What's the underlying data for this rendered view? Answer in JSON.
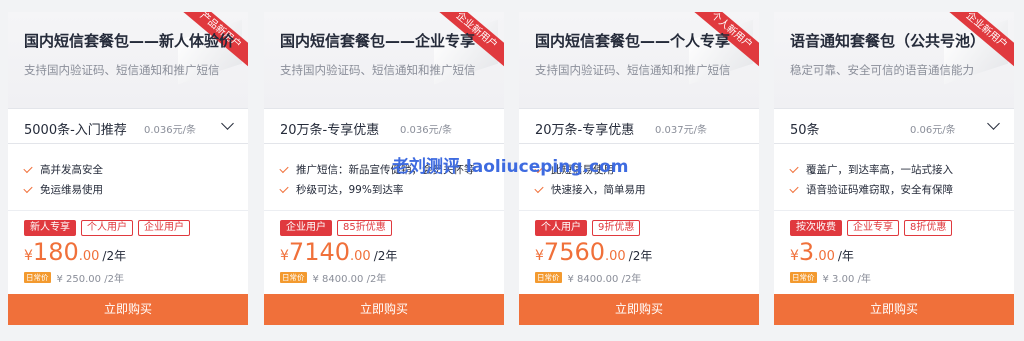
{
  "buy_label": "立即购买",
  "daily_badge_label": "日常价",
  "watermark": "老刘测评 laoliuceping.com",
  "cards": [
    {
      "ribbon": "产品新用户",
      "title": "国内短信套餐包——新人体验价",
      "subtitle": "支持国内验证码、短信通知和推广短信",
      "spec": "5000条-入门推荐",
      "unit_price": "0.036元/条",
      "features": [
        "高并发高安全",
        "免运维易使用"
      ],
      "tags": [
        {
          "label": "新人专享",
          "filled": true
        },
        {
          "label": "个人用户",
          "filled": false
        },
        {
          "label": "企业用户",
          "filled": false
        }
      ],
      "price_currency": "¥",
      "price_int": "180",
      "price_dec": ".00",
      "price_period": "/2年",
      "daily_price": "¥ 250.00 /2年"
    },
    {
      "ribbon": "企业新用户",
      "title": "国内短信套餐包——企业专享",
      "subtitle": "支持国内验证码、短信通知和推广短信",
      "spec": "20万条-专享优惠",
      "unit_price": "0.036元/条",
      "features": [
        "推广短信：新品宣传促销，会员关怀等",
        "秒级可达，99%到达率"
      ],
      "tags": [
        {
          "label": "企业用户",
          "filled": true
        },
        {
          "label": "85折优惠",
          "filled": false
        }
      ],
      "price_currency": "¥",
      "price_int": "7140",
      "price_dec": ".00",
      "price_period": "/2年",
      "daily_price": "¥ 8400.00 /2年"
    },
    {
      "ribbon": "个人新用户",
      "title": "国内短信套餐包——个人专享",
      "subtitle": "支持国内验证码、短信通知和推广短信",
      "spec": "20万条-专享优惠",
      "unit_price": "0.037元/条",
      "features": [
        "此短信易使用",
        "快速接入，简单易用"
      ],
      "tags": [
        {
          "label": "个人用户",
          "filled": true
        },
        {
          "label": "9折优惠",
          "filled": false
        }
      ],
      "price_currency": "¥",
      "price_int": "7560",
      "price_dec": ".00",
      "price_period": "/2年",
      "daily_price": "¥ 8400.00 /2年"
    },
    {
      "ribbon": "企业新用户",
      "title": "语音通知套餐包（公共号池）",
      "subtitle": "稳定可靠、安全可信的语音通信能力",
      "spec": "50条",
      "unit_price": "0.06元/条",
      "features": [
        "覆盖广，到达率高，一站式接入",
        "语音验证码难窃取，安全有保障"
      ],
      "tags": [
        {
          "label": "按次收费",
          "filled": true
        },
        {
          "label": "企业专享",
          "filled": false
        },
        {
          "label": "8折优惠",
          "filled": false
        }
      ],
      "price_currency": "¥",
      "price_int": "3",
      "price_dec": ".00",
      "price_period": "/年",
      "daily_price": "¥ 3.00 /年"
    }
  ]
}
